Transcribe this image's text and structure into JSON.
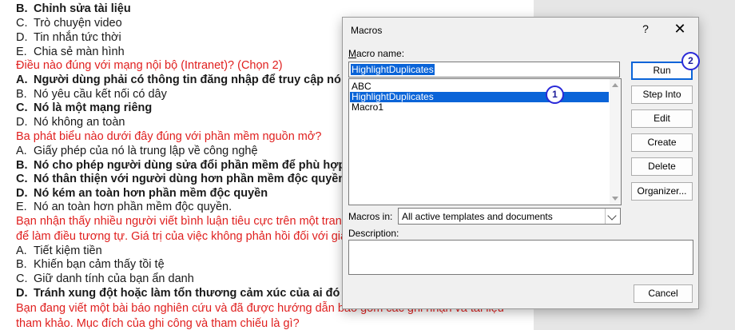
{
  "document": {
    "lines": [
      {
        "letter": "B.",
        "text": "Chỉnh sửa tài liệu",
        "style": "bold"
      },
      {
        "letter": "C.",
        "text": "Trò chuyện video",
        "style": "normal"
      },
      {
        "letter": "D.",
        "text": "Tin nhắn tức thời",
        "style": "normal"
      },
      {
        "letter": "E.",
        "text": "Chia sẻ màn hình",
        "style": "normal"
      },
      {
        "letter": "",
        "text": "Điều nào đúng với mạng nội bộ (Intranet)? (Chọn 2)",
        "style": "red"
      },
      {
        "letter": "A.",
        "text": "Người dùng phải có thông tin đăng nhập để truy cập nó",
        "style": "bold"
      },
      {
        "letter": "B.",
        "text": "Nó yêu cầu kết nối có dây",
        "style": "normal"
      },
      {
        "letter": "C.",
        "text": "Nó là một mạng riêng",
        "style": "bold"
      },
      {
        "letter": "D.",
        "text": "Nó không an toàn",
        "style": "normal"
      },
      {
        "letter": "",
        "text": "Ba phát biểu nào dưới đây đúng với phần mềm nguồn mở?",
        "style": "red"
      },
      {
        "letter": "A.",
        "text": "Giấy phép của nó là trung lập về công nghệ",
        "style": "normal"
      },
      {
        "letter": "B.",
        "text": "Nó cho phép người dùng sửa đổi phần mềm để phù hợp với n",
        "style": "bold"
      },
      {
        "letter": "C.",
        "text": "Nó thân thiện với người dùng hơn phần mềm độc quyền",
        "style": "bold"
      },
      {
        "letter": "D.",
        "text": "Nó kém an toàn hơn phần mềm độc quyền",
        "style": "bold"
      },
      {
        "letter": "E.",
        "text": "Nó an toàn hơn phần mềm độc quyền.",
        "style": "normal"
      },
      {
        "letter": "",
        "text": "Bạn nhận thấy nhiều người viết bình luận tiêu cực trên một trang",
        "style": "red"
      },
      {
        "letter": "",
        "text": "để làm điều tương tự. Giá trị của việc không phản hồi đối với giao",
        "style": "red"
      },
      {
        "letter": "A.",
        "text": "Tiết kiệm tiền",
        "style": "normal"
      },
      {
        "letter": "B.",
        "text": "Khiến bạn cảm thấy tồi tệ",
        "style": "normal"
      },
      {
        "letter": "C.",
        "text": "Giữ danh tính của bạn ẩn danh",
        "style": "normal"
      },
      {
        "letter": "D.",
        "text": "Tránh xung đột hoặc làm tổn thương cảm xúc của ai đó",
        "style": "bold"
      },
      {
        "letter": "",
        "text": "Bạn đang viết một bài báo nghiên cứu và đã được hướng dẫn bao gồm các ghi nhận và tài liệu",
        "style": "red"
      },
      {
        "letter": "",
        "text": "tham khảo. Mục đích của ghi công và tham chiếu là gì?",
        "style": "red"
      }
    ]
  },
  "dialog": {
    "title": "Macros",
    "help_glyph": "?",
    "close_glyph": "✕",
    "macro_name_label": "Macro name:",
    "macro_name_value": "HighlightDuplicates",
    "macros": [
      "ABC",
      "HighlightDuplicates",
      "Macro1"
    ],
    "selected_macro": "HighlightDuplicates",
    "buttons": {
      "run": "Run",
      "step_into": "Step Into",
      "edit": "Edit",
      "create": "Create",
      "delete": "Delete",
      "organizer": "Organizer...",
      "cancel": "Cancel"
    },
    "macros_in_label": "Macros in:",
    "macros_in_value": "All active templates and documents",
    "description_label": "Description:",
    "description_value": ""
  },
  "annotations": {
    "badge1": "1",
    "badge2": "2",
    "color": "#2a2ad8"
  },
  "colors": {
    "question_text": "#e0201f",
    "selection": "#0a64d8"
  }
}
